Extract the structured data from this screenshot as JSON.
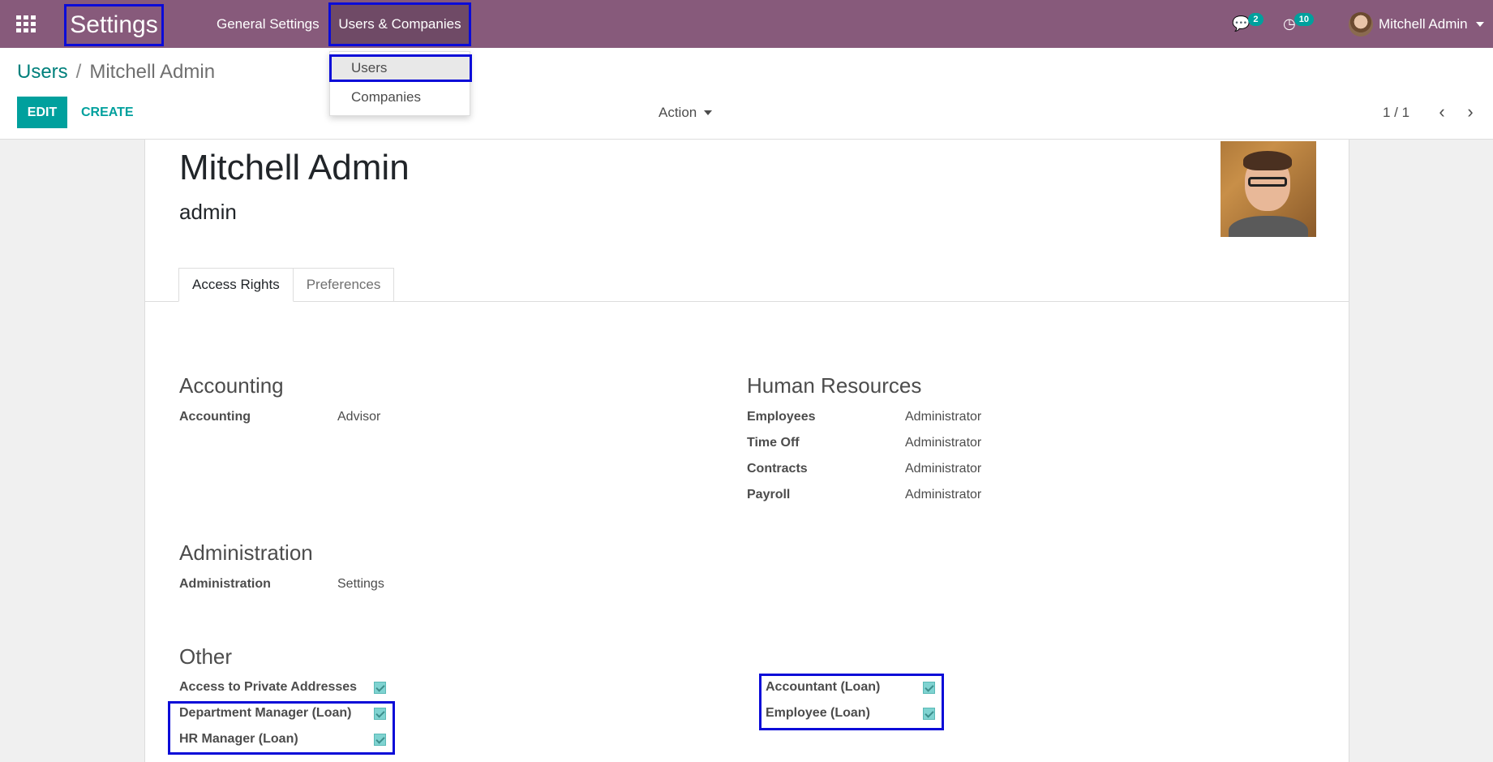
{
  "navbar": {
    "brand": "Settings",
    "menu": [
      "General Settings",
      "Users & Companies"
    ],
    "chat_count": "2",
    "activity_count": "10",
    "user_name": "Mitchell Admin"
  },
  "dropdown": {
    "items": [
      "Users",
      "Companies"
    ]
  },
  "control_panel": {
    "breadcrumb_parent": "Users",
    "breadcrumb_separator": "/",
    "breadcrumb_current": "Mitchell Admin",
    "edit_label": "EDIT",
    "create_label": "CREATE",
    "action_label": "Action",
    "pager": "1 / 1"
  },
  "form": {
    "name": "Mitchell Admin",
    "login": "admin",
    "tabs": [
      "Access Rights",
      "Preferences"
    ],
    "accounting": {
      "title": "Accounting",
      "fields": [
        {
          "label": "Accounting",
          "value": "Advisor"
        }
      ]
    },
    "human_resources": {
      "title": "Human Resources",
      "fields": [
        {
          "label": "Employees",
          "value": "Administrator"
        },
        {
          "label": "Time Off",
          "value": "Administrator"
        },
        {
          "label": "Contracts",
          "value": "Administrator"
        },
        {
          "label": "Payroll",
          "value": "Administrator"
        }
      ]
    },
    "administration": {
      "title": "Administration",
      "fields": [
        {
          "label": "Administration",
          "value": "Settings"
        }
      ]
    },
    "other": {
      "title": "Other",
      "left": [
        {
          "label": "Access to Private Addresses",
          "checked": true
        },
        {
          "label": "Department Manager (Loan)",
          "checked": true
        },
        {
          "label": "HR Manager (Loan)",
          "checked": true
        }
      ],
      "right": [
        {
          "label": "Accountant (Loan)",
          "checked": true
        },
        {
          "label": "Employee (Loan)",
          "checked": true
        }
      ]
    }
  },
  "colors": {
    "navbar": "#875a7b",
    "accent": "#00a09d",
    "highlight": "#0b0bd8"
  }
}
